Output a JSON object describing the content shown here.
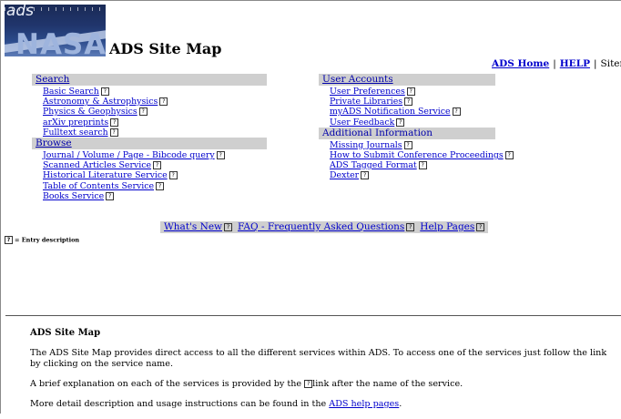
{
  "header": {
    "logo_text": "ads",
    "logo_word": "NASA",
    "title": "ADS Site Map",
    "links": [
      {
        "label": "ADS Home"
      },
      {
        "label": "HELP"
      },
      {
        "label": "Sitemap"
      }
    ]
  },
  "left_sections": [
    {
      "title": "Search",
      "items": [
        "Basic Search",
        "Astronomy & Astrophysics",
        "Physics & Geophysics",
        "arXiv preprints",
        "Fulltext search"
      ]
    },
    {
      "title": "Browse",
      "items": [
        "Journal / Volume / Page - Bibcode query",
        "Scanned Articles Service",
        "Historical Literature Service",
        "Table of Contents Service",
        "Books Service"
      ]
    }
  ],
  "right_sections": [
    {
      "title": "User Accounts",
      "items": [
        "User Preferences",
        "Private Libraries",
        "myADS Notification Service",
        "User Feedback"
      ]
    },
    {
      "title": "Additional Information",
      "items": [
        "Missing Journals",
        "How to Submit Conference Proceedings",
        "ADS Tagged Format",
        "Dexter"
      ]
    }
  ],
  "midbar": [
    "What's New",
    "FAQ - Frequently Asked Questions",
    "Help Pages"
  ],
  "legend": "= Entry description",
  "help_icon_glyph": "?",
  "bottom": {
    "heading": "ADS Site Map",
    "p1": "The ADS Site Map provides direct access to all the different services within ADS. To access one of the services just follow the link by clicking on the service name.",
    "p2a": "A brief explanation on each of the services is provided by the",
    "p2b": "link after the name of the service.",
    "p3a": "More detail description and usage instructions can be found in the",
    "p3_link": "ADS help pages",
    "p3b": "."
  }
}
